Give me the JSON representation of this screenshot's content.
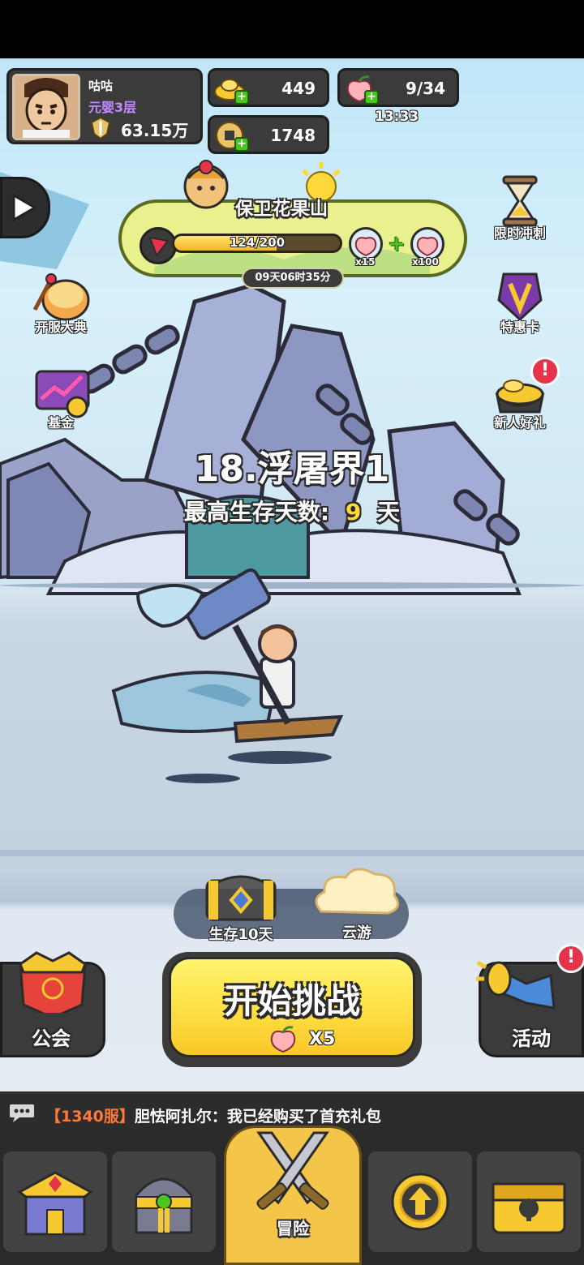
{
  "player": {
    "name": "咕咕",
    "realm": "元婴3层",
    "power": "63.15万"
  },
  "resources": {
    "gold": "449",
    "coin": "1748",
    "peach": "9/34",
    "peach_regen_timer": "13:33"
  },
  "left_menu": {
    "opening_ceremony": "开服大典",
    "fund": "基金"
  },
  "right_menu": {
    "limited_sprint": "限时冲刺",
    "discount_card": "特惠卡",
    "newbie_gift": "新人好礼"
  },
  "event": {
    "title": "保卫花果山",
    "progress_text": "124/200",
    "progress_fraction": 0.62,
    "reward_1_qty": "x15",
    "reward_2_qty": "x100",
    "timer": "09天06时35分"
  },
  "stage": {
    "title": "18.浮屠界1",
    "best_label": "最高生存天数:",
    "best_days": "9",
    "days_unit": "天"
  },
  "rewards_bar": {
    "survive_chest": "生存10天",
    "cloud_travel": "云游"
  },
  "start": {
    "label": "开始挑战",
    "cost": "X5"
  },
  "side_buttons": {
    "guild": "公会",
    "activity": "活动"
  },
  "badges": {
    "exclaim": "!"
  },
  "chat": {
    "server": "【1340服】",
    "message": "胆怯阿扎尔：我已经购买了首充礼包"
  },
  "nav": {
    "adventure": "冒险"
  }
}
